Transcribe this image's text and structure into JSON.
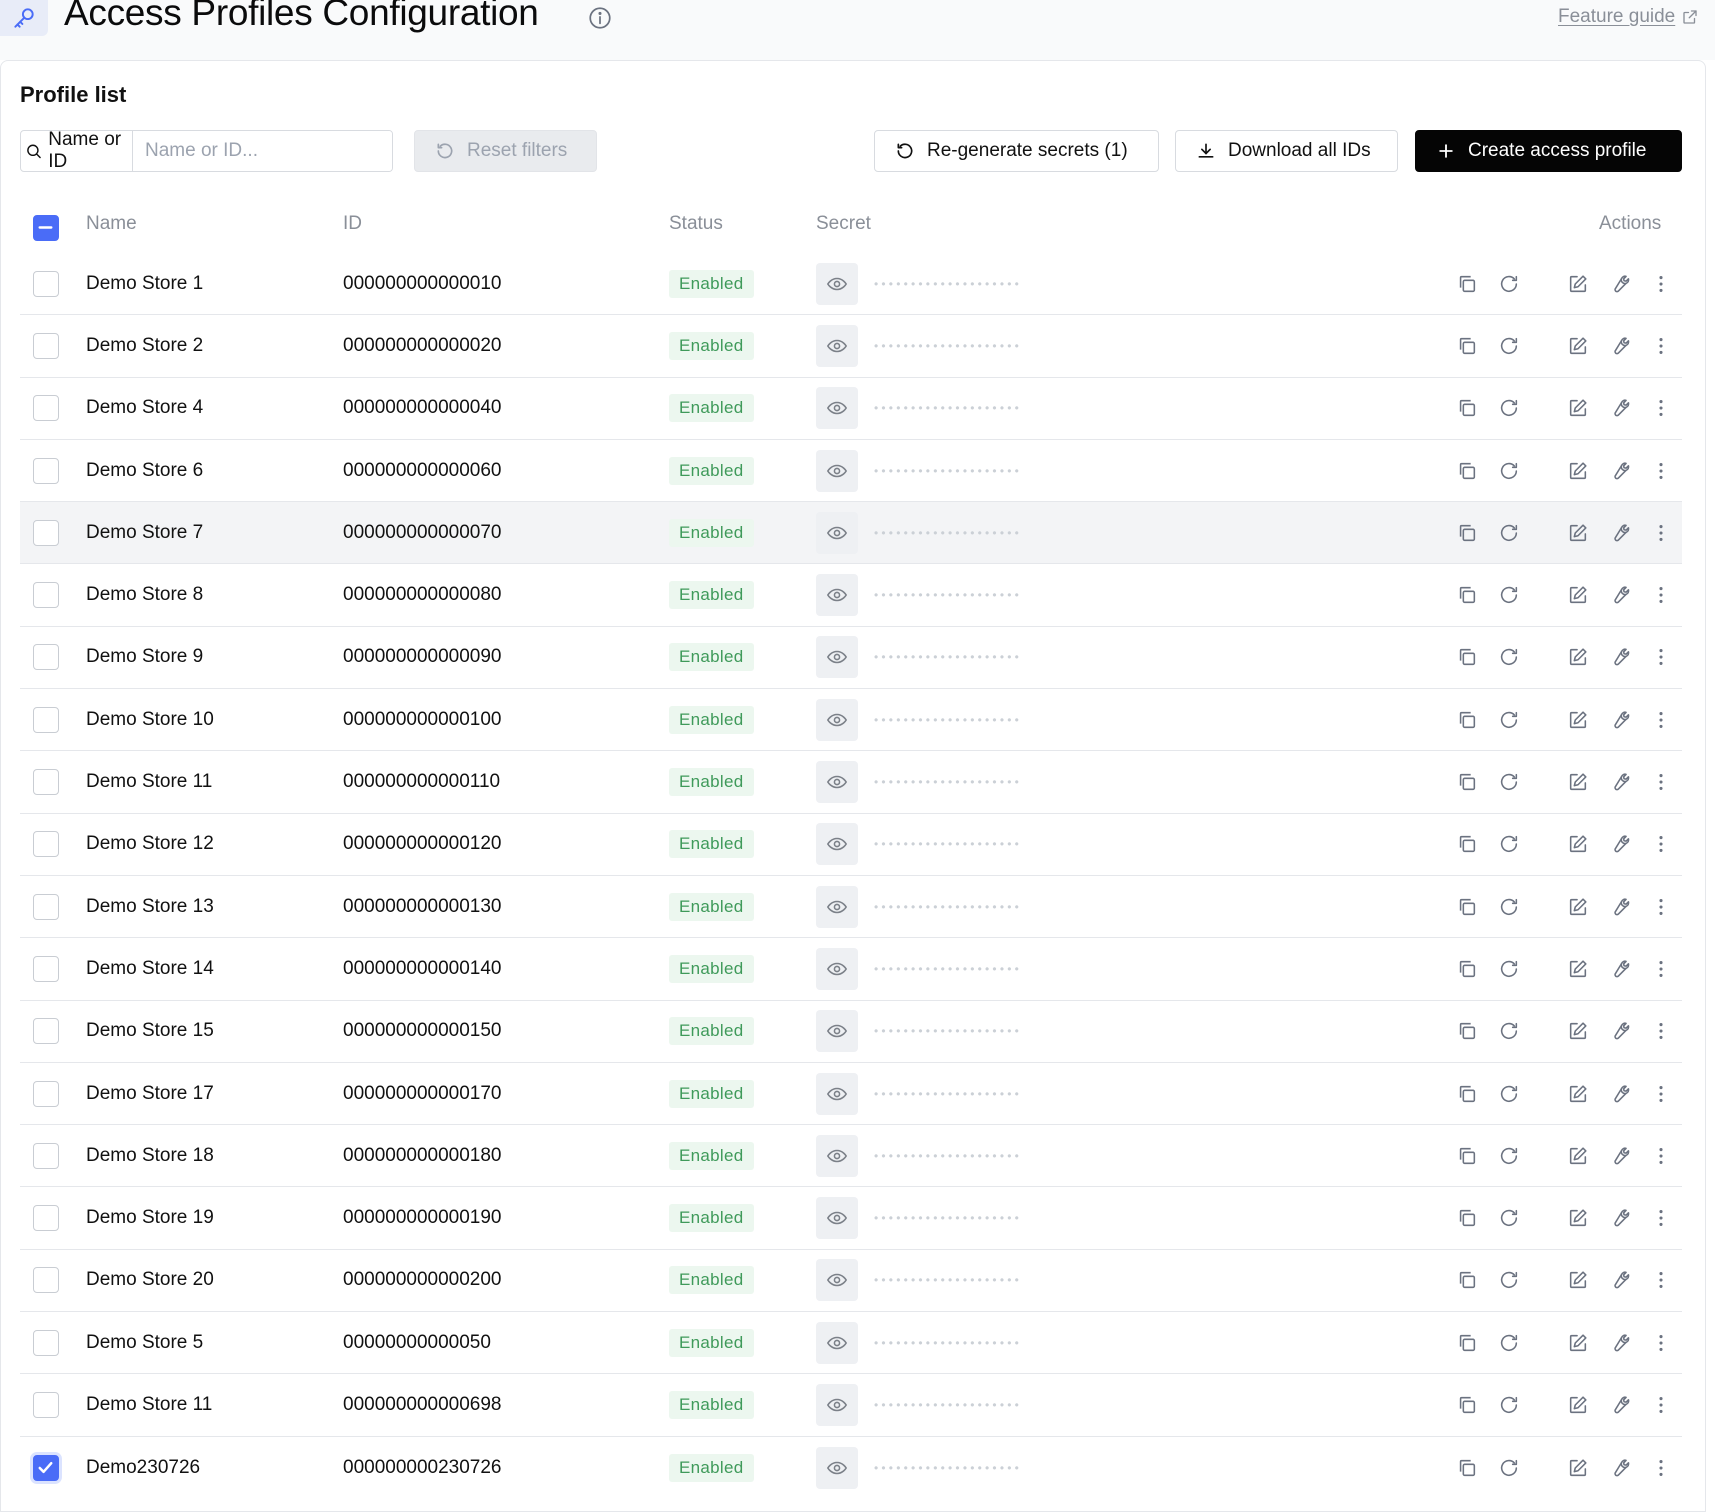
{
  "header": {
    "title": "Access Profiles Configuration",
    "feature_guide": "Feature guide"
  },
  "section": {
    "title": "Profile list"
  },
  "toolbar": {
    "filter_field": "Name or ID",
    "search_placeholder": "Name or ID...",
    "reset_filters": "Reset filters",
    "regenerate": "Re-generate secrets (1)",
    "download": "Download all IDs",
    "create": "Create access profile"
  },
  "table": {
    "columns": {
      "name": "Name",
      "id": "ID",
      "status": "Status",
      "secret": "Secret",
      "actions": "Actions"
    },
    "secret_mask": "••••••••••••••••••••",
    "rows": [
      {
        "name": "Demo Store 1",
        "id": "000000000000010",
        "status": "Enabled",
        "checked": false,
        "highlighted": false
      },
      {
        "name": "Demo Store 2",
        "id": "000000000000020",
        "status": "Enabled",
        "checked": false,
        "highlighted": false
      },
      {
        "name": "Demo Store 4",
        "id": "000000000000040",
        "status": "Enabled",
        "checked": false,
        "highlighted": false
      },
      {
        "name": "Demo Store 6",
        "id": "000000000000060",
        "status": "Enabled",
        "checked": false,
        "highlighted": false
      },
      {
        "name": "Demo Store 7",
        "id": "000000000000070",
        "status": "Enabled",
        "checked": false,
        "highlighted": true
      },
      {
        "name": "Demo Store 8",
        "id": "000000000000080",
        "status": "Enabled",
        "checked": false,
        "highlighted": false
      },
      {
        "name": "Demo Store 9",
        "id": "000000000000090",
        "status": "Enabled",
        "checked": false,
        "highlighted": false
      },
      {
        "name": "Demo Store 10",
        "id": "000000000000100",
        "status": "Enabled",
        "checked": false,
        "highlighted": false
      },
      {
        "name": "Demo Store 11",
        "id": "000000000000110",
        "status": "Enabled",
        "checked": false,
        "highlighted": false
      },
      {
        "name": "Demo Store 12",
        "id": "000000000000120",
        "status": "Enabled",
        "checked": false,
        "highlighted": false
      },
      {
        "name": "Demo Store 13",
        "id": "000000000000130",
        "status": "Enabled",
        "checked": false,
        "highlighted": false
      },
      {
        "name": "Demo Store 14",
        "id": "000000000000140",
        "status": "Enabled",
        "checked": false,
        "highlighted": false
      },
      {
        "name": "Demo Store 15",
        "id": "000000000000150",
        "status": "Enabled",
        "checked": false,
        "highlighted": false
      },
      {
        "name": "Demo Store 17",
        "id": "000000000000170",
        "status": "Enabled",
        "checked": false,
        "highlighted": false
      },
      {
        "name": "Demo Store 18",
        "id": "000000000000180",
        "status": "Enabled",
        "checked": false,
        "highlighted": false
      },
      {
        "name": "Demo Store 19",
        "id": "000000000000190",
        "status": "Enabled",
        "checked": false,
        "highlighted": false
      },
      {
        "name": "Demo Store 20",
        "id": "000000000000200",
        "status": "Enabled",
        "checked": false,
        "highlighted": false
      },
      {
        "name": "Demo Store 5",
        "id": "00000000000050",
        "status": "Enabled",
        "checked": false,
        "highlighted": false
      },
      {
        "name": "Demo Store 11",
        "id": "000000000000698",
        "status": "Enabled",
        "checked": false,
        "highlighted": false
      },
      {
        "name": "Demo230726",
        "id": "000000000230726",
        "status": "Enabled",
        "checked": true,
        "highlighted": false
      }
    ]
  },
  "colors": {
    "accent": "#4a6cf7",
    "primary_button": "#050505",
    "status_enabled_text": "#3f9a5a",
    "status_enabled_bg": "#ecf7ef"
  },
  "icons": {
    "header": "key-icon",
    "info": "info-icon",
    "external": "external-link-icon",
    "search": "search-icon",
    "reset": "reset-icon",
    "regenerate": "refresh-icon",
    "download": "download-icon",
    "create": "plus-icon",
    "row_actions": [
      "copy-icon",
      "refresh-icon",
      "edit-icon",
      "wrench-icon",
      "more-vertical-icon"
    ],
    "secret_toggle": "eye-icon"
  }
}
